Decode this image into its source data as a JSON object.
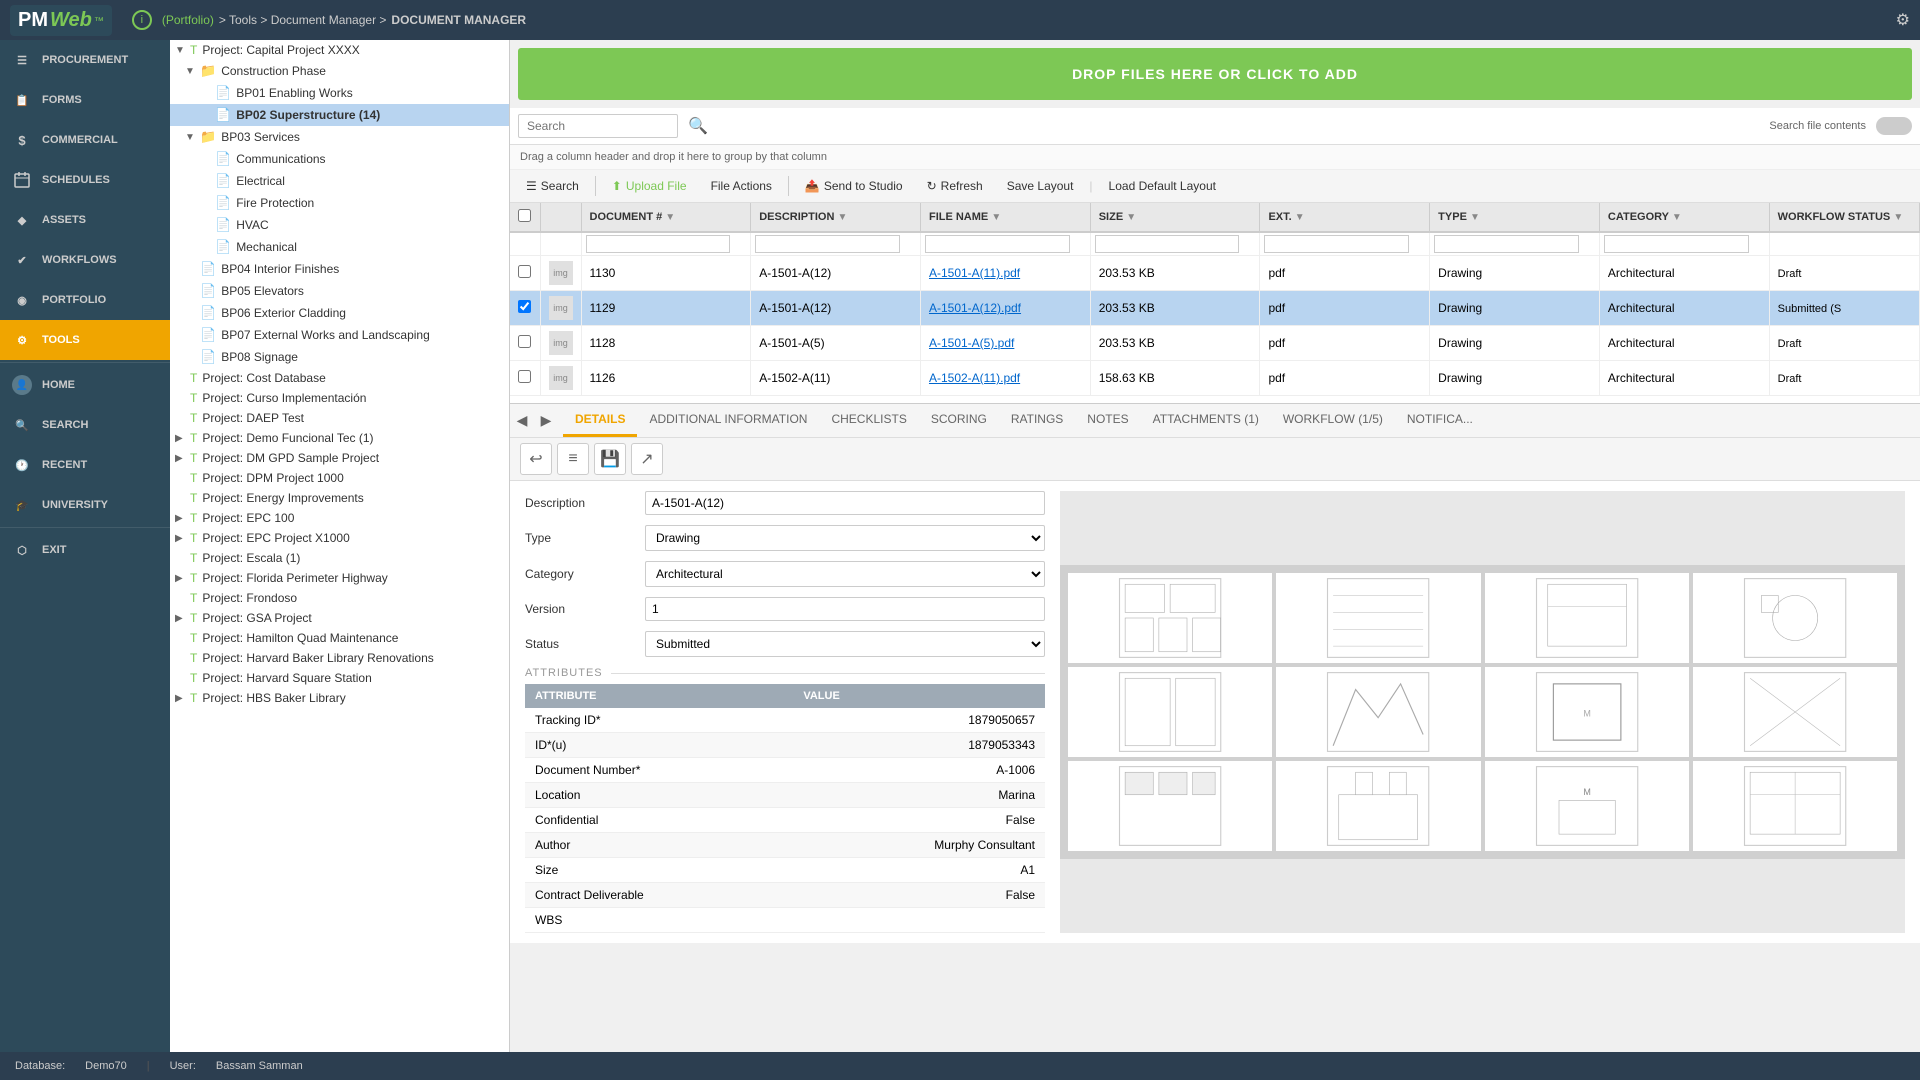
{
  "app": {
    "title": "PMWeb",
    "logo_main": "PM",
    "logo_accent": "Web"
  },
  "topbar": {
    "info_icon": "ℹ",
    "breadcrumb": [
      "(Portfolio)",
      ">",
      "Tools",
      ">",
      "Document Manager",
      ">",
      "DOCUMENT MANAGER"
    ],
    "breadcrumb_link": "(Portfolio)"
  },
  "navigation": {
    "items": [
      {
        "id": "procurement",
        "label": "PROCUREMENT",
        "icon": "☰"
      },
      {
        "id": "forms",
        "label": "FORMS",
        "icon": "📋"
      },
      {
        "id": "commercial",
        "label": "COMMERCIAL",
        "icon": "$"
      },
      {
        "id": "schedules",
        "label": "SCHEDULES",
        "icon": "📅"
      },
      {
        "id": "assets",
        "label": "ASSETS",
        "icon": "🔷"
      },
      {
        "id": "workflows",
        "label": "WORKFLOWS",
        "icon": "✔"
      },
      {
        "id": "portfolio",
        "label": "PORTFOLIO",
        "icon": "◉"
      },
      {
        "id": "tools",
        "label": "TOOLS",
        "icon": "⚙",
        "active": true
      },
      {
        "id": "home",
        "label": "HOME",
        "icon": "👤"
      },
      {
        "id": "search",
        "label": "SEARCH",
        "icon": "🔍"
      },
      {
        "id": "recent",
        "label": "RECENT",
        "icon": "🕐"
      },
      {
        "id": "university",
        "label": "UNIVERSITY",
        "icon": "🎓"
      },
      {
        "id": "exit",
        "label": "EXIT",
        "icon": "⬡"
      }
    ]
  },
  "tree": {
    "items": [
      {
        "id": "capital",
        "label": "Project: Capital Project XXXX",
        "level": 0,
        "type": "project",
        "expanded": true
      },
      {
        "id": "construction",
        "label": "Construction Phase",
        "level": 1,
        "type": "folder",
        "expanded": true
      },
      {
        "id": "bp01",
        "label": "BP01 Enabling Works",
        "level": 2,
        "type": "folder"
      },
      {
        "id": "bp02",
        "label": "BP02 Superstructure (14)",
        "level": 2,
        "type": "folder",
        "selected": true
      },
      {
        "id": "bp03",
        "label": "BP03 Services",
        "level": 1,
        "type": "folder",
        "expanded": true
      },
      {
        "id": "communications",
        "label": "Communications",
        "level": 2,
        "type": "folder"
      },
      {
        "id": "electrical",
        "label": "Electrical",
        "level": 2,
        "type": "folder"
      },
      {
        "id": "fire",
        "label": "Fire Protection",
        "level": 2,
        "type": "folder"
      },
      {
        "id": "hvac",
        "label": "HVAC",
        "level": 2,
        "type": "folder"
      },
      {
        "id": "mechanical",
        "label": "Mechanical",
        "level": 2,
        "type": "folder"
      },
      {
        "id": "bp04",
        "label": "BP04 Interior Finishes",
        "level": 1,
        "type": "folder"
      },
      {
        "id": "bp05",
        "label": "BP05 Elevators",
        "level": 1,
        "type": "folder"
      },
      {
        "id": "bp06",
        "label": "BP06 Exterior Cladding",
        "level": 1,
        "type": "folder"
      },
      {
        "id": "bp07",
        "label": "BP07 External Works and Landscaping",
        "level": 1,
        "type": "folder"
      },
      {
        "id": "bp08",
        "label": "BP08 Signage",
        "level": 1,
        "type": "folder"
      },
      {
        "id": "cost_db",
        "label": "Project: Cost Database",
        "level": 0,
        "type": "project"
      },
      {
        "id": "curso",
        "label": "Project: Curso Implementación",
        "level": 0,
        "type": "project"
      },
      {
        "id": "daep",
        "label": "Project: DAEP Test",
        "level": 0,
        "type": "project"
      },
      {
        "id": "demo_func",
        "label": "Project: Demo Funcional Tec (1)",
        "level": 0,
        "type": "project",
        "has_children": true
      },
      {
        "id": "dm_gpd",
        "label": "Project: DM GPD Sample Project",
        "level": 0,
        "type": "project",
        "has_children": true
      },
      {
        "id": "dpm",
        "label": "Project: DPM Project 1000",
        "level": 0,
        "type": "project"
      },
      {
        "id": "energy",
        "label": "Project: Energy Improvements",
        "level": 0,
        "type": "project"
      },
      {
        "id": "epc100",
        "label": "Project: EPC 100",
        "level": 0,
        "type": "project",
        "has_children": true
      },
      {
        "id": "epcx1000",
        "label": "Project: EPC Project X1000",
        "level": 0,
        "type": "project",
        "has_children": true
      },
      {
        "id": "escala",
        "label": "Project: Escala (1)",
        "level": 0,
        "type": "project"
      },
      {
        "id": "florida",
        "label": "Project: Florida Perimeter Highway",
        "level": 0,
        "type": "project",
        "has_children": true
      },
      {
        "id": "frondoso",
        "label": "Project: Frondoso",
        "level": 0,
        "type": "project"
      },
      {
        "id": "gsa",
        "label": "Project: GSA Project",
        "level": 0,
        "type": "project",
        "has_children": true
      },
      {
        "id": "hamilton",
        "label": "Project: Hamilton Quad Maintenance",
        "level": 0,
        "type": "project"
      },
      {
        "id": "harvard_baker",
        "label": "Project: Harvard Baker Library Renovations",
        "level": 0,
        "type": "project"
      },
      {
        "id": "harvard_sq",
        "label": "Project: Harvard Square Station",
        "level": 0,
        "type": "project"
      },
      {
        "id": "hbs_baker",
        "label": "Project: HBS Baker Library",
        "level": 0,
        "type": "project",
        "has_children": true
      }
    ]
  },
  "dropzone": {
    "label": "DROP FILES HERE OR CLICK TO ADD"
  },
  "file_search": {
    "placeholder": "Search",
    "search_contents_label": "Search file contents"
  },
  "toolbar": {
    "search": "Search",
    "upload": "Upload File",
    "file_actions": "File Actions",
    "send_to_studio": "Send to Studio",
    "refresh": "Refresh",
    "save_layout": "Save Layout",
    "load_default": "Load Default Layout"
  },
  "group_hint": "Drag a column header and drop it here to group by that column",
  "table": {
    "columns": [
      {
        "id": "cb",
        "label": ""
      },
      {
        "id": "preview",
        "label": ""
      },
      {
        "id": "doc_num",
        "label": "DOCUMENT #"
      },
      {
        "id": "desc",
        "label": "DESCRIPTION"
      },
      {
        "id": "filename",
        "label": "FILE NAME"
      },
      {
        "id": "size",
        "label": "SIZE"
      },
      {
        "id": "ext",
        "label": "EXT."
      },
      {
        "id": "type",
        "label": "TYPE"
      },
      {
        "id": "category",
        "label": "CATEGORY"
      },
      {
        "id": "workflow_status",
        "label": "WORKFLOW STATUS"
      }
    ],
    "rows": [
      {
        "doc_num": "1130",
        "desc": "A-1501-A(12)",
        "filename": "A-1501-A(11).pdf",
        "size": "203.53 KB",
        "ext": "pdf",
        "type": "Drawing",
        "category": "Architectural",
        "status": "Draft",
        "selected": false
      },
      {
        "doc_num": "1129",
        "desc": "A-1501-A(12)",
        "filename": "A-1501-A(12).pdf",
        "size": "203.53 KB",
        "ext": "pdf",
        "type": "Drawing",
        "category": "Architectural",
        "status": "Submitted (S",
        "selected": true
      },
      {
        "doc_num": "1128",
        "desc": "A-1501-A(5)",
        "filename": "A-1501-A(5).pdf",
        "size": "203.53 KB",
        "ext": "pdf",
        "type": "Drawing",
        "category": "Architectural",
        "status": "Draft",
        "selected": false
      },
      {
        "doc_num": "1126",
        "desc": "A-1502-A(11)",
        "filename": "A-1502-A(11).pdf",
        "size": "158.63 KB",
        "ext": "pdf",
        "type": "Drawing",
        "category": "Architectural",
        "status": "Draft",
        "selected": false
      }
    ]
  },
  "details": {
    "tabs": [
      {
        "id": "details",
        "label": "DETAILS",
        "active": true
      },
      {
        "id": "additional",
        "label": "ADDITIONAL INFORMATION"
      },
      {
        "id": "checklists",
        "label": "CHECKLISTS"
      },
      {
        "id": "scoring",
        "label": "SCORING"
      },
      {
        "id": "ratings",
        "label": "RATINGS"
      },
      {
        "id": "notes",
        "label": "NOTES"
      },
      {
        "id": "attachments",
        "label": "ATTACHMENTS (1)"
      },
      {
        "id": "workflow",
        "label": "WORKFLOW (1/5)"
      },
      {
        "id": "notifica",
        "label": "NOTIFICA..."
      }
    ],
    "form": {
      "description_label": "Description",
      "description_value": "A-1501-A(12)",
      "type_label": "Type",
      "type_value": "Drawing",
      "category_label": "Category",
      "category_value": "Architectural",
      "version_label": "Version",
      "version_value": "1",
      "status_label": "Status",
      "status_value": "Submitted",
      "attributes_title": "ATTRIBUTES"
    },
    "attributes": {
      "columns": [
        "ATTRIBUTE",
        "VALUE"
      ],
      "rows": [
        {
          "attr": "Tracking ID*",
          "value": "1879050657"
        },
        {
          "attr": "ID*(u)",
          "value": "1879053343"
        },
        {
          "attr": "Document Number*",
          "value": "A-1006"
        },
        {
          "attr": "Location",
          "value": "Marina"
        },
        {
          "attr": "Confidential",
          "value": "False"
        },
        {
          "attr": "Author",
          "value": "Murphy Consultant"
        },
        {
          "attr": "Size",
          "value": "A1"
        },
        {
          "attr": "Contract Deliverable",
          "value": "False"
        },
        {
          "attr": "WBS",
          "value": ""
        }
      ]
    }
  },
  "status_bar": {
    "database_label": "Database:",
    "database_value": "Demo70",
    "user_label": "User:",
    "user_value": "Bassam Samman"
  },
  "colors": {
    "accent_green": "#7dc855",
    "accent_orange": "#f0a500",
    "sidebar_bg": "#2d4a5a",
    "topbar_bg": "#2c3e50",
    "active_nav": "#f0a500"
  }
}
